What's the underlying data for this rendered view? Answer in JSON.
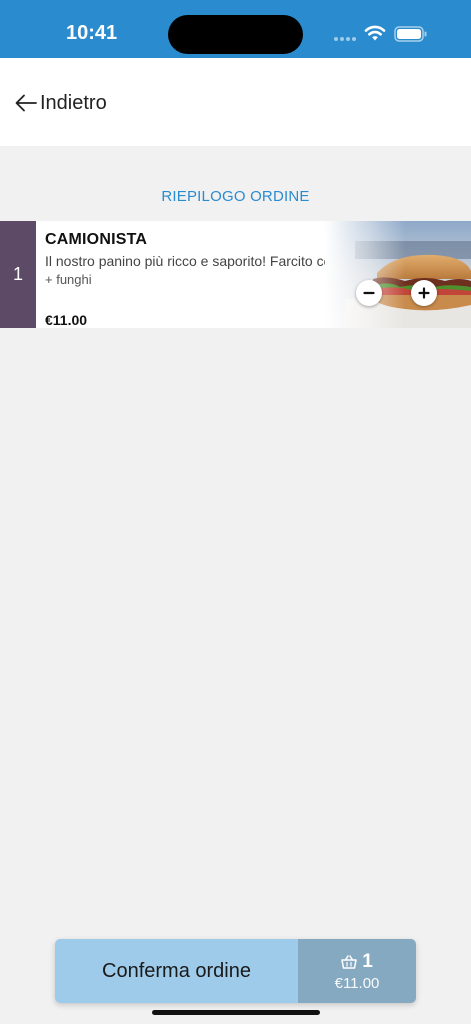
{
  "status_bar": {
    "time": "10:41",
    "icons": [
      "signal-icon",
      "wifi-icon",
      "battery-icon"
    ]
  },
  "header": {
    "back_label": "Indietro",
    "back_icon": "arrow-left-icon"
  },
  "section": {
    "title": "RIEPILOGO ORDINE"
  },
  "order_items": [
    {
      "quantity": "1",
      "name": "CAMIONISTA",
      "description": "Il nostro panino più ricco e saporito! Farcito con..",
      "addon": "+ funghi",
      "price": "€11.00",
      "image": "sandwich-photo"
    }
  ],
  "footer": {
    "confirm_label": "Conferma ordine",
    "cart_count": "1",
    "cart_total": "€11.00",
    "cart_icon": "basket-icon"
  },
  "colors": {
    "accent": "#2a8bcf",
    "qty_badge": "#5c4a66",
    "confirm_button": "#9fcbea",
    "cart_summary": "#86a9c2",
    "background": "#f1f1f1"
  }
}
